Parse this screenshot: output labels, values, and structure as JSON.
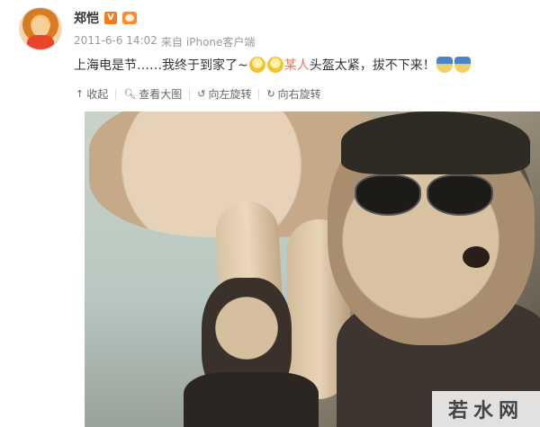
{
  "post": {
    "username": "郑恺",
    "verified_badge": "V",
    "timestamp": "2011-6-6 14:02",
    "source_prefix": "来自",
    "source": "iPhone客户端",
    "text_part1": "上海电是节……我终于到家了~",
    "mention": "某人",
    "text_part2": "头盔太紧，拔不下来！"
  },
  "actions": {
    "collapse": "收起",
    "view_large": "查看大图",
    "rotate_left": "向左旋转",
    "rotate_right": "向右旋转"
  },
  "icons": {
    "collapse": "arrow-up-icon",
    "view_large": "magnifier-icon",
    "rotate_left": "rotate-left-icon",
    "rotate_right": "rotate-right-icon",
    "emoji": "crying-face-icon",
    "helmet": "helmet-face-icon"
  },
  "watermark": "若水网",
  "colors": {
    "mention": "#eb7350",
    "verified": "#f37b1d",
    "meta": "#999999"
  }
}
